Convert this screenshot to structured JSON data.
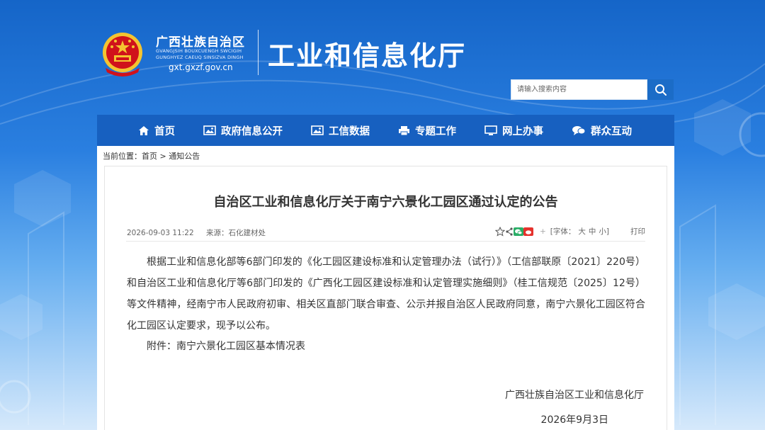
{
  "header": {
    "region_cn": "广西壮族自治区",
    "region_zhuang_1": "GVANGJSIH BOUXCUENGH SWCIGIH",
    "region_zhuang_2": "GUNGHYEZ CAEUQ SINSIZVA DINGH",
    "region_url": "gxt.gxzf.gov.cn",
    "dept_title": "工业和信息化厅"
  },
  "search": {
    "placeholder": "请输入搜索内容"
  },
  "nav": {
    "items": [
      {
        "label": "首页",
        "icon": "home-icon"
      },
      {
        "label": "政府信息公开",
        "icon": "picture-icon"
      },
      {
        "label": "工信数据",
        "icon": "picture-icon"
      },
      {
        "label": "专题工作",
        "icon": "printer-icon"
      },
      {
        "label": "网上办事",
        "icon": "monitor-icon"
      },
      {
        "label": "群众互动",
        "icon": "chat-icon"
      }
    ]
  },
  "breadcrumb": {
    "prefix": "当前位置：",
    "home": "首页",
    "sep": ">",
    "current": "通知公告"
  },
  "article": {
    "title": "自治区工业和信息化厅关于南宁六景化工园区通过认定的公告",
    "datetime": "2026-09-03 11:22",
    "source": "来源：石化建材处",
    "font_size_label": "[字体：",
    "font_large": "大",
    "font_medium": "中",
    "font_small": "小]",
    "plus": "+",
    "print": "打印",
    "body": "根据工业和信息化部等6部门印发的《化工园区建设标准和认定管理办法（试行）》（工信部联原〔2021〕220号）和自治区工业和信息化厅等6部门印发的《广西化工园区建设标准和认定管理实施细则》（桂工信规范〔2025〕12号）等文件精神，经南宁市人民政府初审、相关区直部门联合审查、公示并报自治区人民政府同意，南宁六景化工园区符合化工园区认定要求，现予以公布。",
    "attachment": "附件：南宁六景化工园区基本情况表",
    "sign_org": "广西壮族自治区工业和信息化厅",
    "sign_date": "2026年9月3日"
  },
  "colors": {
    "nav_bg": "#1760c0",
    "search_btn": "#1b6cc7",
    "emblem_red": "#d0121b",
    "emblem_gold": "#f4c430"
  }
}
